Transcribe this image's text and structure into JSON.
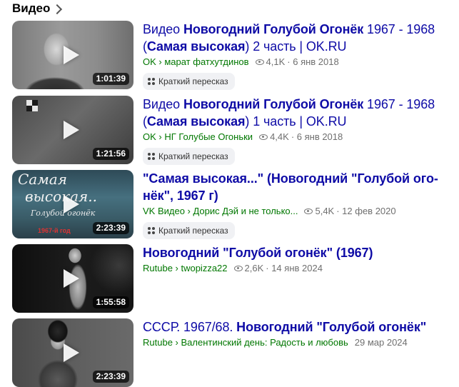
{
  "section": {
    "title": "Видео"
  },
  "summary_label": "Краткий пересказ",
  "videos": [
    {
      "title_plain_1": "Видео ",
      "title_bold_1": "Новогодний Голубой Огонёк",
      "title_plain_2": " 1967 - 1968 (",
      "title_bold_2": "Самая высокая",
      "title_plain_3": ") 2 часть | OK.RU",
      "source": "OK › марат фатхутдинов",
      "views": "4,1K",
      "date": "· 6 янв 2018",
      "duration": "1:01:39"
    },
    {
      "title_plain_1": "Видео ",
      "title_bold_1": "Новогодний Голубой Огонёк",
      "title_plain_2": " 1967 - 1968 (",
      "title_bold_2": "Самая высокая",
      "title_plain_3": ") 1 часть | OK.RU",
      "source": "OK › НГ Голубые Огоньки",
      "views": "4,4K",
      "date": "· 6 янв 2018",
      "duration": "1:21:56"
    },
    {
      "title_bold_1": "\"Самая высокая...\" (Новогодний \"Голубой ого-нёк\"",
      "title_plain_2": ", 1967 г)",
      "source": "VK Видео › Дорис Дэй и не только...",
      "views": "5,4K",
      "date": "· 12 фев 2020",
      "duration": "2:23:39",
      "thumb_text_1": "Самая",
      "thumb_text_2": "высокая..",
      "thumb_text_3": "Голубой огонёк",
      "thumb_text_4": "1967-й год"
    },
    {
      "title_bold_1": "Новогодний \"Голубой огонёк\"",
      "title_plain_2": " (1967)",
      "source": "Rutube › twopizza22",
      "views": "2,6K",
      "date": "· 14 янв 2024",
      "duration": "1:55:58"
    },
    {
      "title_plain_1": "СССР. 1967/68. ",
      "title_bold_1": "Новогодний \"Голубой огонёк\"",
      "source": "Rutube › Валентинский день: Радость и любовь",
      "date": "29 мар 2024",
      "duration": "2:23:39"
    }
  ]
}
